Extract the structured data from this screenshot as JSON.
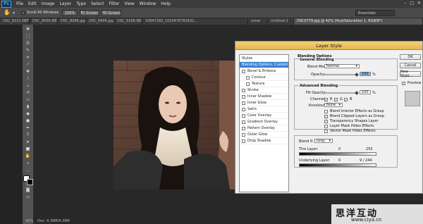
{
  "app": {
    "logo": "Ps"
  },
  "menu": [
    "File",
    "Edit",
    "Image",
    "Layer",
    "Type",
    "Select",
    "Filter",
    "View",
    "Window",
    "Help"
  ],
  "window_controls": [
    "–",
    "□",
    "✕"
  ],
  "options": {
    "scroll_all": "Scroll All Windows",
    "zoom_100": "100%",
    "fit_screen": "Fit Screen",
    "fill_screen": "Fill Screen",
    "workspace": "Essentials"
  },
  "tabs": [
    "DSC_8221.NEF",
    "DSC_8500.NEF",
    "DSC_8098.jpg",
    "DSC_8409.jpg",
    "DSC_8168.NEF",
    "10647282_1020476781832...",
    "snow",
    "Untitled-1",
    "DSC0779.jpg @ 42% (Hue/Saturation 1, RGB/8*)"
  ],
  "status": {
    "zoom": "42%",
    "doc": "Doc: 4.39M/4.39M"
  },
  "dialog": {
    "title": "Layer Style",
    "styles": [
      {
        "label": "Styles",
        "check": false,
        "hdr": true
      },
      {
        "label": "Blending Options: Custom",
        "check": false,
        "sel": true
      },
      {
        "label": "Bevel & Emboss",
        "check": true,
        "on": false
      },
      {
        "label": "Contour",
        "check": true,
        "on": false,
        "sub": true
      },
      {
        "label": "Texture",
        "check": true,
        "on": false,
        "sub": true
      },
      {
        "label": "Stroke",
        "check": true,
        "on": false
      },
      {
        "label": "Inner Shadow",
        "check": true,
        "on": false
      },
      {
        "label": "Inner Glow",
        "check": true,
        "on": false
      },
      {
        "label": "Satin",
        "check": true,
        "on": false
      },
      {
        "label": "Color Overlay",
        "check": true,
        "on": false
      },
      {
        "label": "Gradient Overlay",
        "check": true,
        "on": false
      },
      {
        "label": "Pattern Overlay",
        "check": true,
        "on": false
      },
      {
        "label": "Outer Glow",
        "check": true,
        "on": false
      },
      {
        "label": "Drop Shadow",
        "check": true,
        "on": false
      }
    ],
    "blending_options": "Blending Options",
    "general_blending": "General Blending",
    "blend_mode_label": "Blend Mode:",
    "blend_mode": "Normal",
    "opacity_label": "Opacity:",
    "opacity": "100",
    "pct": "%",
    "advanced_blending": "Advanced Blending",
    "fill_opacity_label": "Fill Opacity:",
    "fill_opacity": "100",
    "channels_label": "Channels:",
    "channels": [
      "R",
      "G",
      "B"
    ],
    "knockout_label": "Knockout:",
    "knockout": "None",
    "adv_checks": [
      {
        "label": "Blend Interior Effects as Group",
        "on": false
      },
      {
        "label": "Blend Clipped Layers as Group",
        "on": true
      },
      {
        "label": "Transparency Shapes Layer",
        "on": true
      },
      {
        "label": "Layer Mask Hides Effects",
        "on": false
      },
      {
        "label": "Vector Mask Hides Effects",
        "on": false
      }
    ],
    "blend_if_label": "Blend If:",
    "blend_if": "Gray",
    "this_layer_label": "This Layer:",
    "this_layer_min": "0",
    "this_layer_max": "255",
    "underlying_label": "Underlying Layer:",
    "underlying_min": "0",
    "underlying_max": "9 / 244",
    "ok": "OK",
    "cancel": "Cancel",
    "new_style": "New Style...",
    "preview": "Preview"
  },
  "watermark": {
    "cn": "思洋互动",
    "url": "www.ciya.cn"
  }
}
